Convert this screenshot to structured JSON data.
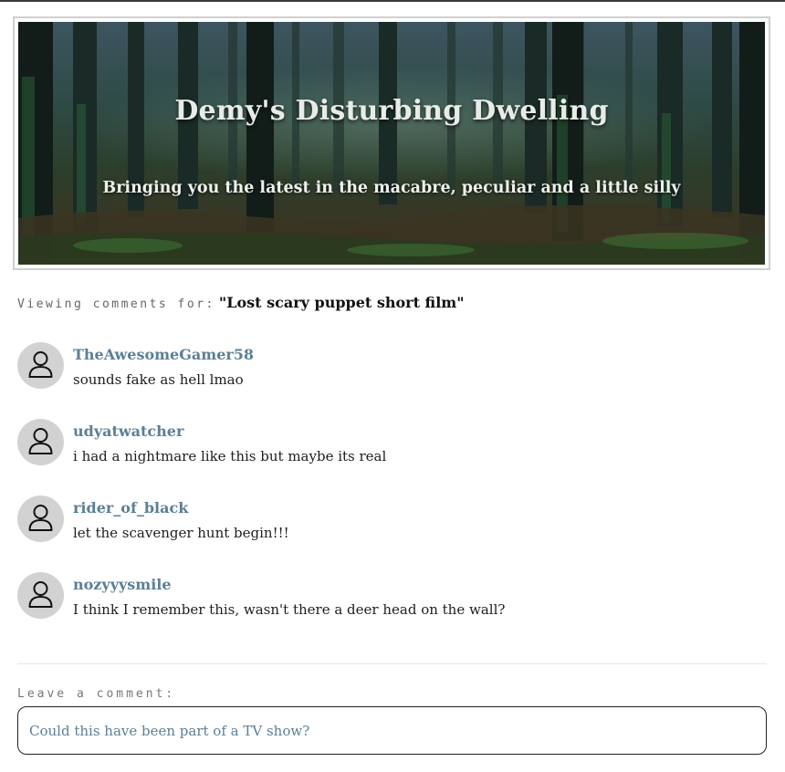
{
  "banner": {
    "title": "Demy's Disturbing Dwelling",
    "subtitle": "Bringing you the latest in the macabre, peculiar and a little silly"
  },
  "viewing": {
    "label": "Viewing comments for:",
    "post_title": "\"Lost scary puppet short film\""
  },
  "comments": [
    {
      "username": "TheAwesomeGamer58",
      "text": "sounds fake as hell lmao",
      "avatar_icon": "user-icon"
    },
    {
      "username": "udyatwatcher",
      "text": "i had a nightmare like this but maybe its real",
      "avatar_icon": "user-icon"
    },
    {
      "username": "rider_of_black",
      "text": "let the scavenger hunt begin!!!",
      "avatar_icon": "user-icon"
    },
    {
      "username": "nozyyysmile",
      "text": "I think I remember this, wasn't there a deer head on the wall?",
      "avatar_icon": "user-icon"
    }
  ],
  "leave_comment": {
    "label": "Leave a comment:",
    "placeholder": "Could this have been part of a TV show?"
  },
  "colors": {
    "username": "#5b7f96",
    "avatar_bg": "#d2d2d2",
    "forest_dark": "#2c3e2a"
  }
}
